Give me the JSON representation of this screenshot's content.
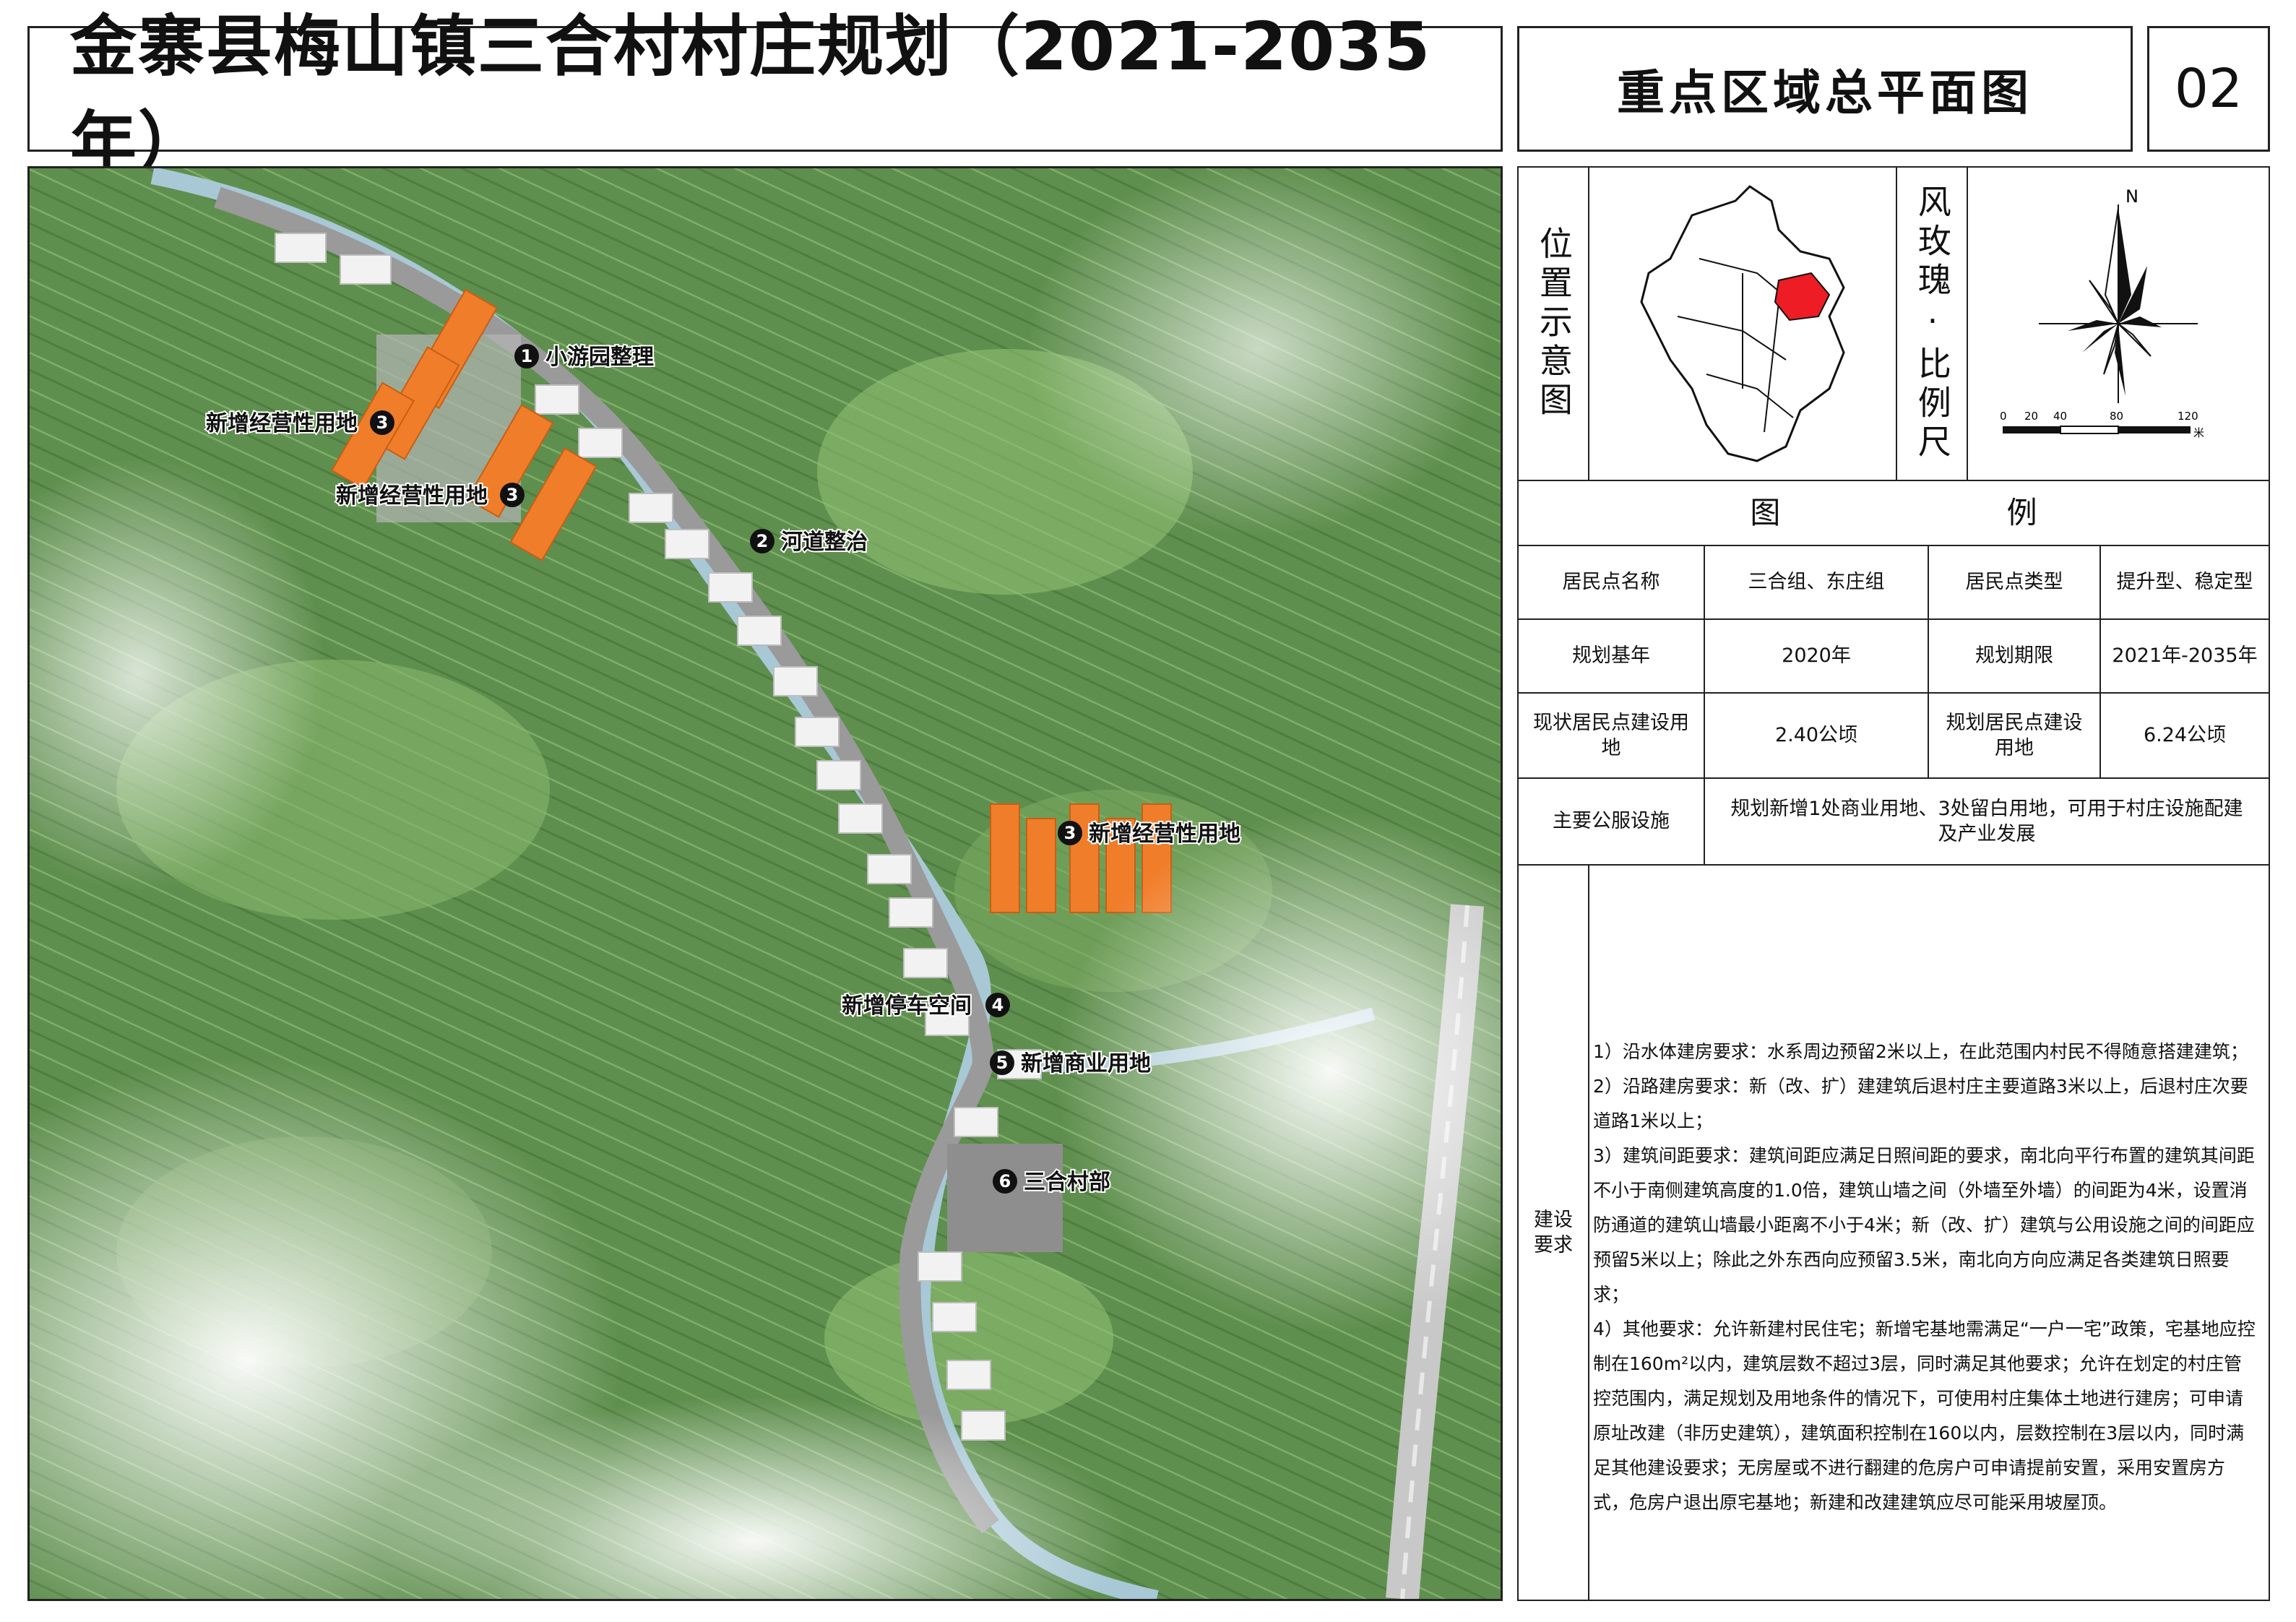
{
  "header": {
    "title": "金寨县梅山镇三合村村庄规划（2021-2035年）",
    "subtitle": "重点区域总平面图",
    "sheet_number": "02"
  },
  "location_panel": {
    "label": "位置示意图",
    "highlight_color": "#ee1c25"
  },
  "compass_panel": {
    "label": "风玫瑰·比例尺",
    "north": "N",
    "scale_ticks": [
      "0",
      "20",
      "40",
      "80",
      "120"
    ],
    "scale_unit": "米"
  },
  "legend": {
    "title": "图 例",
    "rows": [
      {
        "k1": "居民点名称",
        "v1": "三合组、东庄组",
        "k2": "居民点类型",
        "v2": "提升型、稳定型"
      },
      {
        "k1": "规划基年",
        "v1": "2020年",
        "k2": "规划期限",
        "v2": "2021年-2035年"
      },
      {
        "k1": "现状居民点建设用地",
        "v1": "2.40公顷",
        "k2": "规划居民点建设用地",
        "v2": "6.24公顷"
      }
    ],
    "public_facilities": {
      "key": "主要公服设施",
      "value": "规划新增1处商业用地、3处留白用地，可用于村庄设施配建及产业发展"
    }
  },
  "requirements": {
    "key": "建设要求",
    "items": [
      "1）沿水体建房要求：水系周边预留2米以上，在此范围内村民不得随意搭建建筑；",
      "2）沿路建房要求：新（改、扩）建建筑后退村庄主要道路3米以上，后退村庄次要道路1米以上；",
      "3）建筑间距要求：建筑间距应满足日照间距的要求，南北向平行布置的建筑其间距不小于南侧建筑高度的1.0倍，建筑山墙之间（外墙至外墙）的间距为4米，设置消防通道的建筑山墙最小距离不小于4米；新（改、扩）建筑与公用设施之间的间距应预留5米以上；除此之外东西向应预留3.5米，南北向方向应满足各类建筑日照要求；",
      "4）其他要求：允许新建村民住宅；新增宅基地需满足“一户一宅”政策，宅基地应控制在160m²以内，建筑层数不超过3层，同时满足其他要求；允许在划定的村庄管控范围内，满足规划及用地条件的情况下，可使用村庄集体土地进行建房；可申请原址改建（非历史建筑），建筑面积控制在160以内，层数控制在3层以内，同时满足其他建设要求；无房屋或不进行翻建的危房户可申请提前安置，采用安置房方式，危房户退出原宅基地；新建和改建建筑应尽可能采用坡屋顶。"
    ]
  },
  "map": {
    "colors": {
      "vegetation": "#6f9a5c",
      "river": "#a8c8d6",
      "road": "#9a9a9a",
      "new_land": "#f07d2a",
      "building": "#f2f2f2"
    },
    "labels": [
      {
        "num": "1",
        "text": "小游园整理"
      },
      {
        "num": "2",
        "text": "河道整治"
      },
      {
        "num": "3",
        "text": "新增经营性用地"
      },
      {
        "num": "3",
        "text": "新增经营性用地"
      },
      {
        "num": "3",
        "text": "新增经营性用地"
      },
      {
        "num": "4",
        "text": "新增停车空间"
      },
      {
        "num": "5",
        "text": "新增商业用地"
      },
      {
        "num": "6",
        "text": "三合村部"
      }
    ]
  }
}
